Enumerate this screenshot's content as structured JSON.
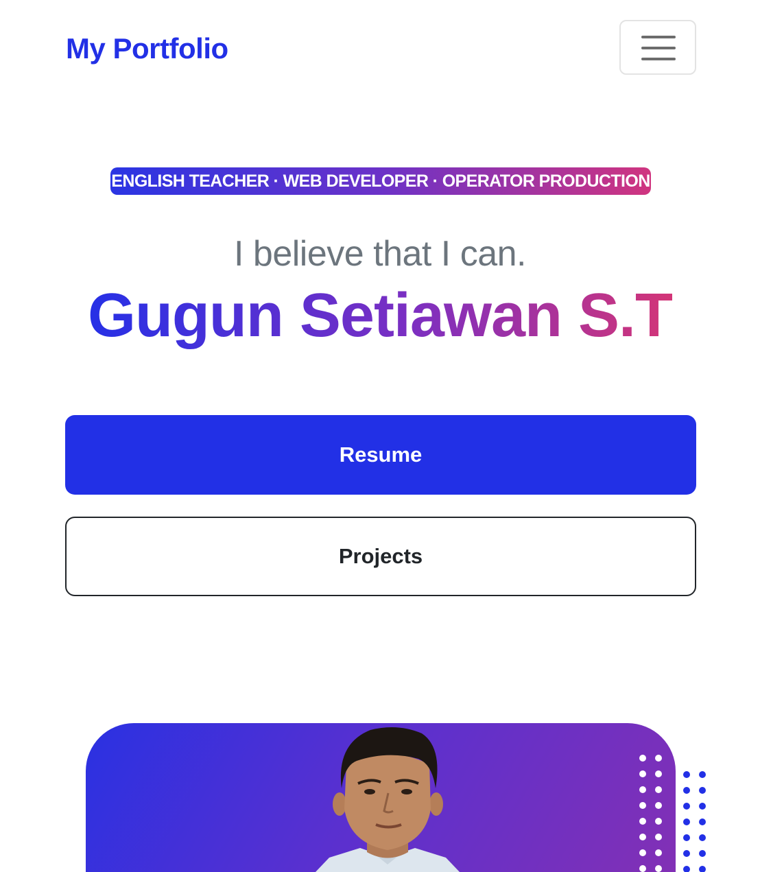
{
  "navbar": {
    "brand": "My Portfolio",
    "toggler_icon": "hamburger-menu-icon"
  },
  "hero": {
    "tagline": "ENGLISH TEACHER · WEB DEVELOPER · OPERATOR PRODUCTION",
    "belief": "I believe that I can.",
    "name": "Gugun Setiawan S.T",
    "buttons": {
      "resume": "Resume",
      "projects": "Projects"
    }
  },
  "colors": {
    "brand_blue": "#2230e6",
    "gradient_start": "#2a35e3",
    "gradient_mid": "#6b32c8",
    "gradient_end": "#d0357f",
    "muted_text": "#6c757d"
  }
}
